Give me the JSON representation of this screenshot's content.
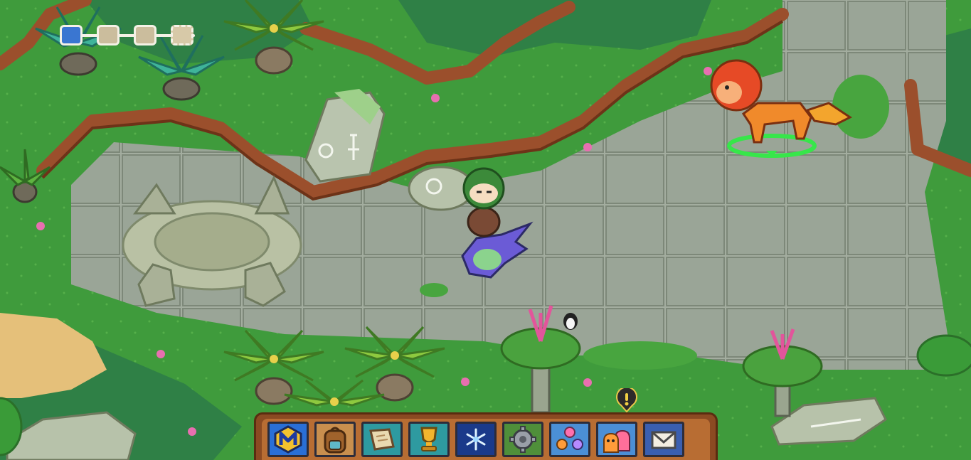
{
  "progress": {
    "steps": [
      {
        "state": "complete"
      },
      {
        "state": "locked"
      },
      {
        "state": "locked"
      },
      {
        "state": "boss"
      }
    ]
  },
  "toolbar": {
    "buttons": [
      {
        "icon": "membership-m-icon",
        "color": "#2a6fd6"
      },
      {
        "icon": "backpack-icon",
        "color": "#c98f4e"
      },
      {
        "icon": "map-scroll-icon",
        "color": "#2e9aa0"
      },
      {
        "icon": "trophy-icon",
        "color": "#2e9aa0"
      },
      {
        "icon": "snowflake-icon",
        "color": "#1a3a8a"
      },
      {
        "icon": "gear-icon",
        "color": "#4f8f3a"
      },
      {
        "icon": "social-orbs-icon",
        "color": "#4b8fd6"
      },
      {
        "icon": "friends-icon",
        "color": "#4b8fd6"
      },
      {
        "icon": "mail-icon",
        "color": "#3a5fb0"
      }
    ],
    "alert_icon": "exclamation-alert-icon"
  },
  "colors": {
    "grass": "#3f9b3c",
    "dark_grass": "#2f7f43",
    "dirt_cliff": "#9b4f2c",
    "stone_tile": "#9ca69a",
    "sand": "#e5c07a",
    "hostile_ring": "#37e64a"
  }
}
